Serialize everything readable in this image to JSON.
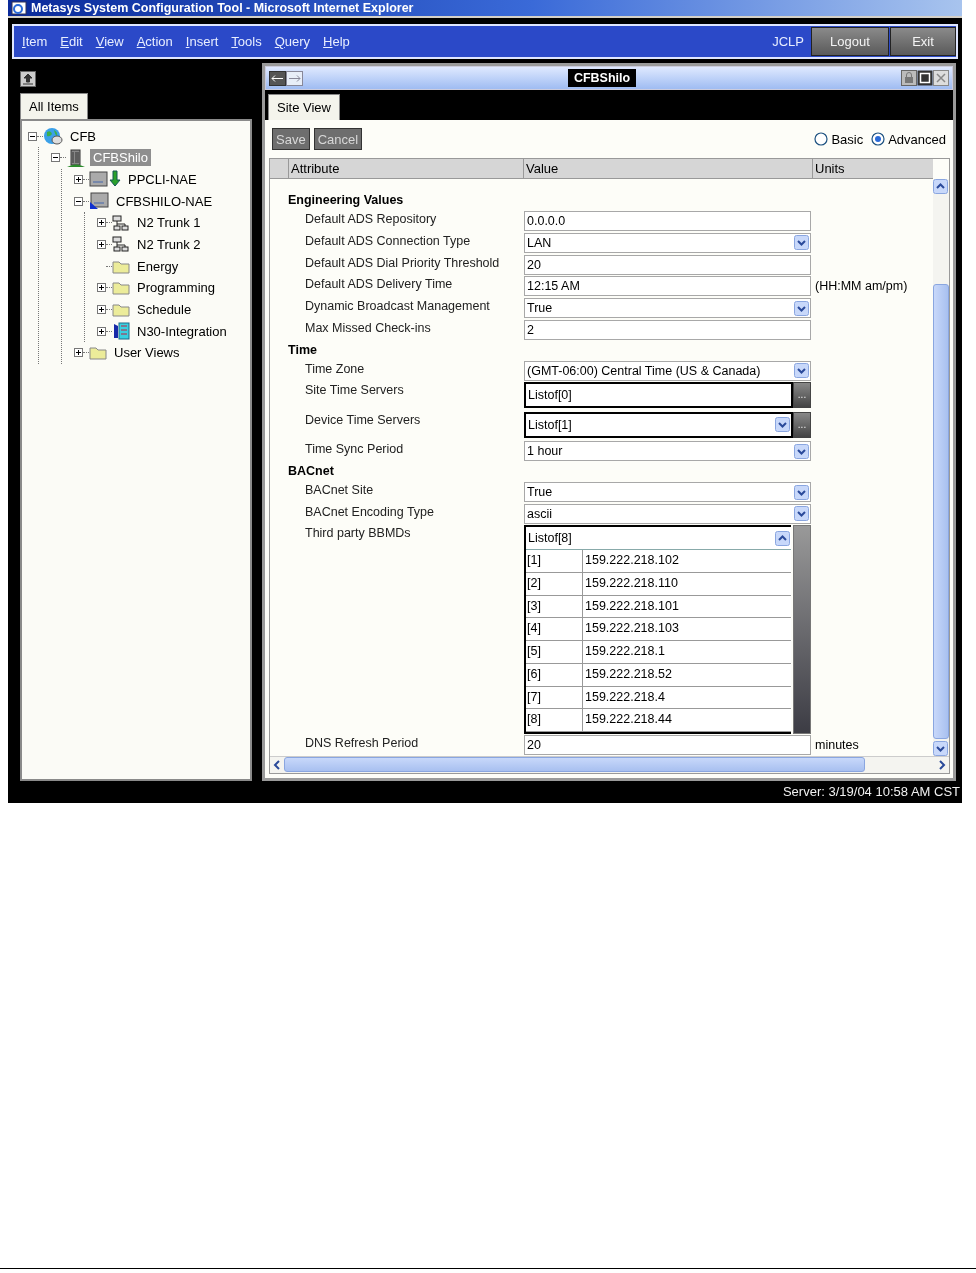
{
  "window": {
    "title": "Metasys System Configuration Tool - Microsoft Internet Explorer"
  },
  "menu": {
    "items": [
      "Item",
      "Edit",
      "View",
      "Action",
      "Insert",
      "Tools",
      "Query",
      "Help"
    ],
    "user": "JCLP",
    "buttons": [
      "Logout",
      "Exit"
    ]
  },
  "navigator": {
    "tabs": [
      {
        "label": "All Items",
        "selected": true
      }
    ],
    "tree": [
      {
        "label": "CFB",
        "kind": "globe",
        "expanded": true,
        "selected": false,
        "children": [
          {
            "label": "CFBShilo",
            "kind": "building",
            "expanded": true,
            "selected": true,
            "children": [
              {
                "label": "PPCLI-NAE",
                "kind": "device-arrow",
                "expanded": false,
                "selected": false
              },
              {
                "label": "CFBSHILO-NAE",
                "kind": "device-flag",
                "expanded": true,
                "selected": false,
                "children": [
                  {
                    "label": "N2 Trunk 1",
                    "kind": "trunk",
                    "expanded": false,
                    "selected": false
                  },
                  {
                    "label": "N2 Trunk 2",
                    "kind": "trunk",
                    "expanded": false,
                    "selected": false
                  },
                  {
                    "label": "Energy",
                    "kind": "folder",
                    "selected": false
                  },
                  {
                    "label": "Programming",
                    "kind": "folder",
                    "expanded": false,
                    "selected": false
                  },
                  {
                    "label": "Schedule",
                    "kind": "folder",
                    "expanded": false,
                    "selected": false
                  },
                  {
                    "label": "N30-Integration",
                    "kind": "integration",
                    "expanded": false,
                    "selected": false
                  }
                ]
              },
              {
                "label": "User Views",
                "kind": "folder",
                "expanded": false,
                "selected": false
              }
            ]
          }
        ]
      }
    ]
  },
  "panel": {
    "title": "CFBShilo",
    "tabs": [
      {
        "label": "Site View",
        "selected": true
      }
    ],
    "actions": [
      {
        "label": "Save",
        "disabled": true
      },
      {
        "label": "Cancel",
        "disabled": true
      }
    ],
    "view_modes": [
      {
        "label": "Basic",
        "selected": false
      },
      {
        "label": "Advanced",
        "selected": true
      }
    ],
    "columns": [
      "Attribute",
      "Value",
      "Units"
    ],
    "sections": [
      {
        "title": "Engineering Values",
        "rows": [
          {
            "attribute": "Default ADS Repository",
            "kind": "text",
            "value": "0.0.0.0"
          },
          {
            "attribute": "Default ADS Connection Type",
            "kind": "select",
            "value": "LAN"
          },
          {
            "attribute": "Default ADS Dial Priority Threshold",
            "kind": "text",
            "value": "20"
          },
          {
            "attribute": "Default ADS Delivery Time",
            "kind": "text",
            "value": "12:15 AM",
            "units": "(HH:MM am/pm)"
          },
          {
            "attribute": "Dynamic Broadcast Management",
            "kind": "select",
            "value": "True"
          },
          {
            "attribute": "Max Missed Check-ins",
            "kind": "text",
            "value": "2"
          }
        ]
      },
      {
        "title": "Time",
        "rows": [
          {
            "attribute": "Time Zone",
            "kind": "select",
            "value": "(GMT-06:00) Central Time (US & Canada)"
          },
          {
            "attribute": "Site Time Servers",
            "kind": "list",
            "value": "Listof[0]",
            "button": "..."
          },
          {
            "attribute": "Device Time Servers",
            "kind": "list-select",
            "value": "Listof[1]",
            "button": "..."
          },
          {
            "attribute": "Time Sync Period",
            "kind": "select",
            "value": "1 hour"
          }
        ]
      },
      {
        "title": "BACnet",
        "rows": [
          {
            "attribute": "BACnet Site",
            "kind": "select",
            "value": "True"
          },
          {
            "attribute": "BACnet Encoding Type",
            "kind": "select",
            "value": "ascii"
          },
          {
            "attribute": "Third party BBMDs",
            "kind": "list-open",
            "value": "Listof[8]",
            "entries": [
              {
                "index": "[1]",
                "address": "159.222.218.102"
              },
              {
                "index": "[2]",
                "address": "159.222.218.110"
              },
              {
                "index": "[3]",
                "address": "159.222.218.101"
              },
              {
                "index": "[4]",
                "address": "159.222.218.103"
              },
              {
                "index": "[5]",
                "address": "159.222.218.1"
              },
              {
                "index": "[6]",
                "address": "159.222.218.52"
              },
              {
                "index": "[7]",
                "address": "159.222.218.4"
              },
              {
                "index": "[8]",
                "address": "159.222.218.44"
              }
            ]
          },
          {
            "attribute": "DNS Refresh Period",
            "kind": "text",
            "value": "20",
            "units": "minutes"
          }
        ]
      }
    ]
  },
  "status_bar": "Server: 3/19/04 10:58 AM CST"
}
